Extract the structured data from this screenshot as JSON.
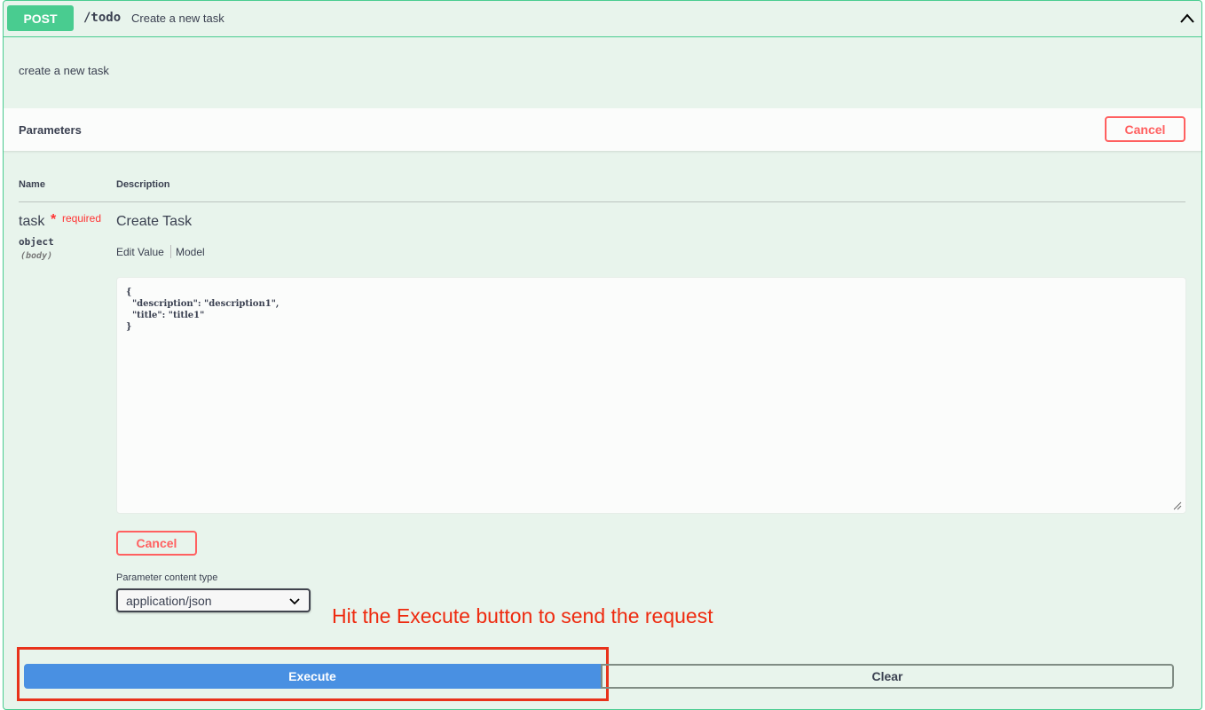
{
  "operation": {
    "method": "POST",
    "path": "/todo",
    "summary": "Create a new task",
    "description": "create a new task"
  },
  "parameters": {
    "title": "Parameters",
    "cancel_label": "Cancel",
    "headers": {
      "name": "Name",
      "description": "Description"
    },
    "param": {
      "name": "task",
      "required_star": "*",
      "required_label": "required",
      "type": "object",
      "in": "(body)",
      "description": "Create Task",
      "tabs": {
        "edit_value": "Edit Value",
        "model": "Model"
      },
      "body_value": "{\n  \"description\": \"description1\",\n  \"title\": \"title1\"\n}"
    },
    "editor_cancel_label": "Cancel",
    "content_type_label": "Parameter content type",
    "content_type_value": "application/json"
  },
  "annotation": "Hit the Execute button to send the request",
  "actions": {
    "execute_label": "Execute",
    "clear_label": "Clear"
  },
  "colors": {
    "post_green": "#49cc90",
    "cancel_red": "#ff6060",
    "execute_blue": "#4990e2",
    "annotation_red": "#ee2a0f"
  }
}
